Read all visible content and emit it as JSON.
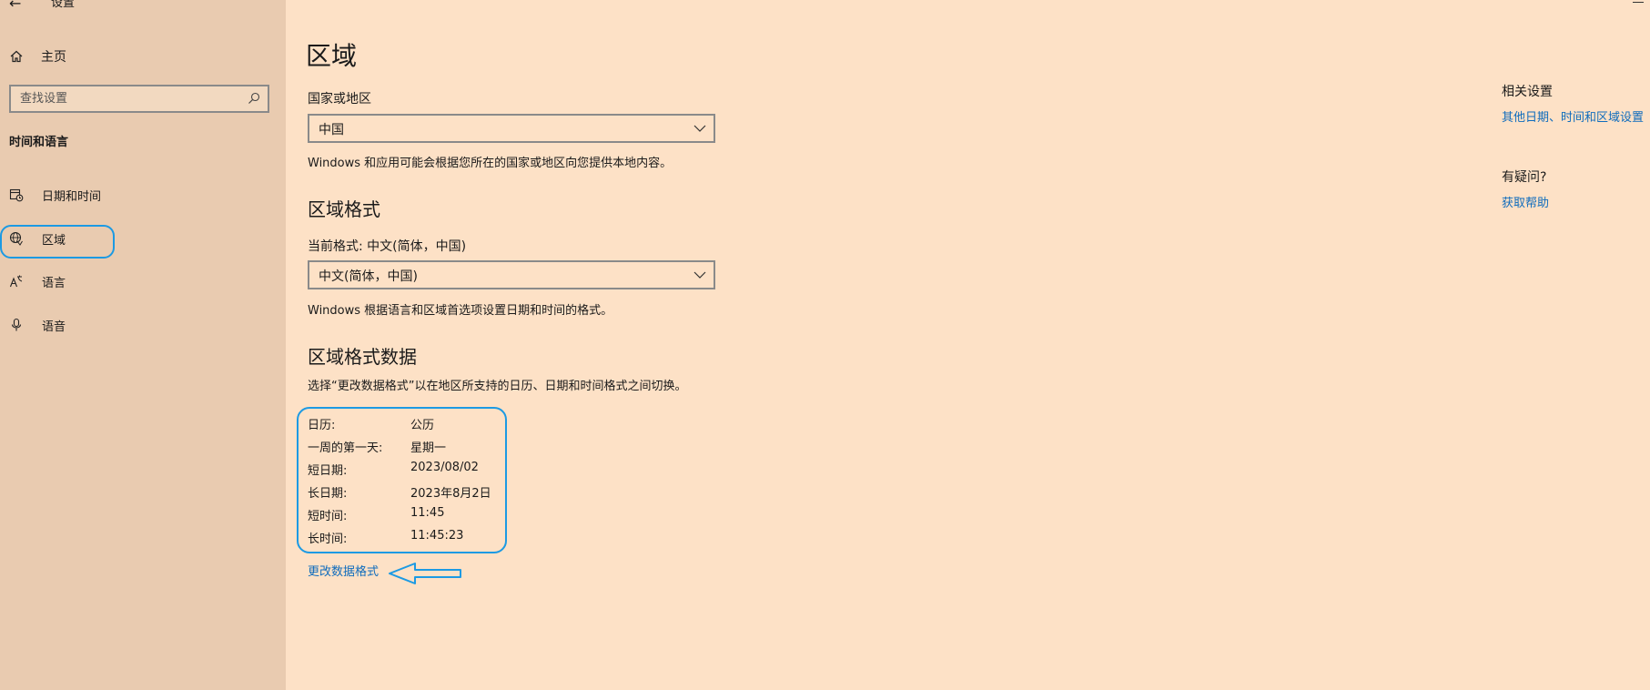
{
  "window": {
    "title": "设置"
  },
  "sidebar": {
    "home_label": "主页",
    "search_placeholder": "查找设置",
    "section_heading": "时间和语言",
    "items": [
      {
        "label": "日期和时间",
        "icon": "calendar-clock-icon"
      },
      {
        "label": "区域",
        "icon": "globe-icon",
        "selected": true
      },
      {
        "label": "语言",
        "icon": "language-icon"
      },
      {
        "label": "语音",
        "icon": "microphone-icon"
      }
    ]
  },
  "main": {
    "title": "区域",
    "country": {
      "label": "国家或地区",
      "value": "中国",
      "description": "Windows 和应用可能会根据您所在的国家或地区向您提供本地内容。"
    },
    "format": {
      "heading": "区域格式",
      "current_label": "当前格式: 中文(简体，中国)",
      "value": "中文(简体，中国)",
      "description": "Windows 根据语言和区域首选项设置日期和时间的格式。"
    },
    "format_data": {
      "heading": "区域格式数据",
      "description": "选择“更改数据格式”以在地区所支持的日历、日期和时间格式之间切换。",
      "rows": [
        {
          "key": "日历:",
          "value": "公历"
        },
        {
          "key": "一周的第一天:",
          "value": "星期一"
        },
        {
          "key": "短日期:",
          "value": "2023/08/02"
        },
        {
          "key": "长日期:",
          "value": "2023年8月2日"
        },
        {
          "key": "短时间:",
          "value": "11:45"
        },
        {
          "key": "长时间:",
          "value": "11:45:23"
        }
      ],
      "change_link": "更改数据格式"
    }
  },
  "related": {
    "heading": "相关设置",
    "link": "其他日期、时间和区域设置",
    "help_heading": "有疑问?",
    "help_link": "获取帮助"
  },
  "colors": {
    "sidebar_bg": "#e9cbb0",
    "main_bg": "#fde1c6",
    "link": "#0f6cbd",
    "annotation": "#1c9ae3"
  }
}
